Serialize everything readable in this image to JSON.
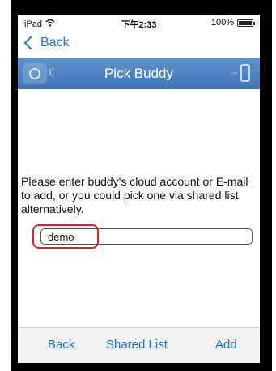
{
  "statusbar": {
    "device": "iPad",
    "time": "下午2:33",
    "battery": "100%",
    "battery_level": 1.0
  },
  "nav": {
    "back_label": "Back"
  },
  "header": {
    "title": "Pick Buddy"
  },
  "main": {
    "instruction": "Please enter buddy's cloud account or E-mail to add, or you could pick one via shared list alternatively.",
    "buddy_input_value": "demo"
  },
  "toolbar": {
    "back_label": "Back",
    "shared_list_label": "Shared List",
    "add_label": "Add"
  },
  "colors": {
    "accent": "#1a73e8",
    "header": "#4a80c0",
    "highlight": "#e0202a"
  }
}
